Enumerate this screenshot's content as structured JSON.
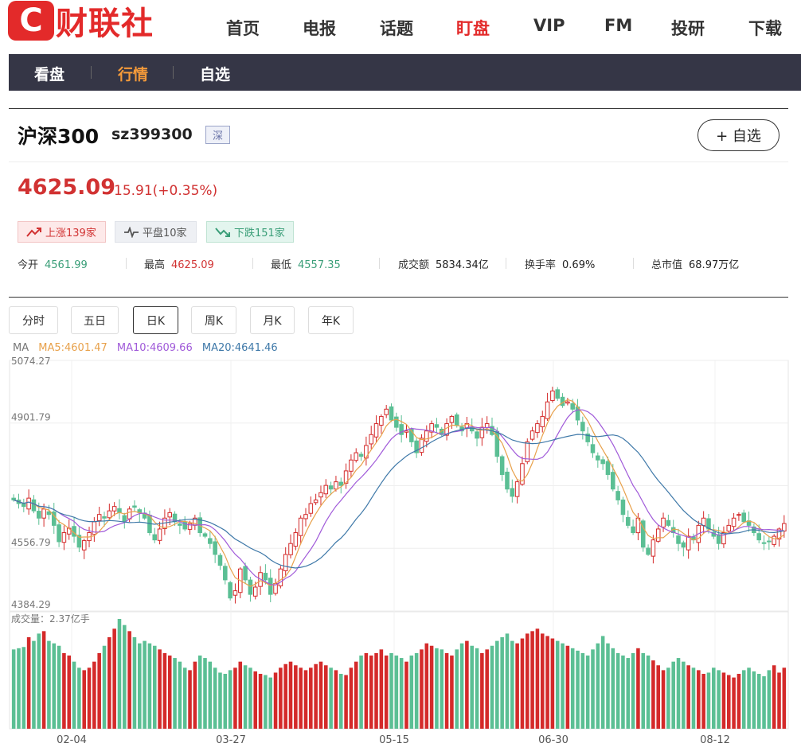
{
  "logo": {
    "letter": "C",
    "name": "财联社"
  },
  "nav": [
    "首页",
    "电报",
    "话题",
    "盯盘",
    "VIP",
    "FM",
    "投研",
    "下载"
  ],
  "nav_active": "盯盘",
  "subnav": [
    "看盘",
    "行情",
    "自选"
  ],
  "subnav_active": "行情",
  "stock": {
    "name": "沪深300",
    "code": "sz399300",
    "tag": "深",
    "add_label": "+ 自选",
    "price": "4625.09",
    "change": "15.91(+0.35%)"
  },
  "badges": {
    "up": "上涨139家",
    "flat": "平盘10家",
    "down": "下跌151家"
  },
  "stats": [
    {
      "label": "今开",
      "value": "4561.99",
      "color": "g"
    },
    {
      "label": "最高",
      "value": "4625.09",
      "color": "r"
    },
    {
      "label": "最低",
      "value": "4557.35",
      "color": "g"
    },
    {
      "label": "成交额",
      "value": "5834.34亿",
      "color": "k"
    },
    {
      "label": "换手率",
      "value": "0.69%",
      "color": "k"
    },
    {
      "label": "总市值",
      "value": "68.97万亿",
      "color": "k"
    }
  ],
  "tabs": [
    "分时",
    "五日",
    "日K",
    "周K",
    "月K",
    "年K"
  ],
  "tab_active": "日K",
  "ma": {
    "label": "MA",
    "ma5": "MA5:4601.47",
    "ma10": "MA10:4609.66",
    "ma20": "MA20:4641.46"
  },
  "colors": {
    "up": "#d42a2a",
    "down": "#5bbf94",
    "ma5": "#e8a14b",
    "ma10": "#a05ad9",
    "ma20": "#3e78a8",
    "accent": "#e32a2a"
  },
  "chart_data": {
    "type": "candlestick",
    "y_ticks": [
      "5074.27",
      "4901.79",
      "4556.79",
      "4384.29"
    ],
    "ylim": [
      4384.29,
      5074.27
    ],
    "x_ticks": [
      "02-04",
      "03-27",
      "05-15",
      "06-30",
      "08-12"
    ],
    "volume_label": "成交量：2.37亿手",
    "close": [
      4690,
      4680,
      4672,
      4695,
      4660,
      4640,
      4665,
      4650,
      4620,
      4575,
      4600,
      4612,
      4590,
      4560,
      4578,
      4600,
      4630,
      4650,
      4640,
      4660,
      4672,
      4655,
      4630,
      4665,
      4670,
      4655,
      4640,
      4600,
      4580,
      4610,
      4640,
      4655,
      4630,
      4620,
      4610,
      4625,
      4640,
      4600,
      4590,
      4570,
      4540,
      4510,
      4470,
      4420,
      4440,
      4500,
      4470,
      4430,
      4450,
      4490,
      4470,
      4430,
      4460,
      4500,
      4540,
      4570,
      4600,
      4640,
      4650,
      4680,
      4690,
      4710,
      4730,
      4720,
      4740,
      4730,
      4770,
      4800,
      4820,
      4810,
      4840,
      4870,
      4900,
      4920,
      4940,
      4910,
      4890,
      4870,
      4880,
      4850,
      4820,
      4860,
      4880,
      4900,
      4890,
      4870,
      4900,
      4920,
      4895,
      4880,
      4900,
      4880,
      4860,
      4890,
      4900,
      4870,
      4810,
      4760,
      4720,
      4700,
      4740,
      4790,
      4850,
      4880,
      4900,
      4920,
      4960,
      4990,
      4970,
      4950,
      4960,
      4940,
      4910,
      4880,
      4850,
      4820,
      4800,
      4790,
      4760,
      4720,
      4690,
      4650,
      4620,
      4600,
      4640,
      4560,
      4540,
      4580,
      4610,
      4640,
      4620,
      4600,
      4570,
      4560,
      4590,
      4580,
      4620,
      4640,
      4610,
      4590,
      4570,
      4600,
      4620,
      4640,
      4650,
      4630,
      4620,
      4600,
      4580,
      4570,
      4575,
      4590,
      4610,
      4625
    ],
    "volume": [
      0.65,
      0.66,
      0.67,
      0.75,
      0.72,
      0.78,
      0.8,
      0.72,
      0.7,
      0.68,
      0.62,
      0.6,
      0.55,
      0.5,
      0.48,
      0.5,
      0.55,
      0.62,
      0.68,
      0.75,
      0.82,
      0.9,
      0.85,
      0.8,
      0.75,
      0.7,
      0.72,
      0.7,
      0.68,
      0.65,
      0.62,
      0.6,
      0.58,
      0.55,
      0.5,
      0.48,
      0.55,
      0.6,
      0.58,
      0.55,
      0.5,
      0.46,
      0.45,
      0.48,
      0.5,
      0.55,
      0.52,
      0.5,
      0.47,
      0.45,
      0.44,
      0.42,
      0.46,
      0.5,
      0.53,
      0.55,
      0.52,
      0.5,
      0.48,
      0.5,
      0.53,
      0.55,
      0.52,
      0.5,
      0.48,
      0.45,
      0.44,
      0.5,
      0.55,
      0.6,
      0.62,
      0.6,
      0.62,
      0.65,
      0.6,
      0.62,
      0.6,
      0.58,
      0.55,
      0.6,
      0.62,
      0.65,
      0.7,
      0.68,
      0.66,
      0.65,
      0.62,
      0.6,
      0.65,
      0.7,
      0.72,
      0.68,
      0.66,
      0.62,
      0.65,
      0.68,
      0.72,
      0.75,
      0.78,
      0.72,
      0.7,
      0.74,
      0.78,
      0.8,
      0.82,
      0.78,
      0.76,
      0.74,
      0.72,
      0.7,
      0.68,
      0.66,
      0.64,
      0.62,
      0.6,
      0.65,
      0.7,
      0.76,
      0.7,
      0.66,
      0.62,
      0.6,
      0.58,
      0.62,
      0.66,
      0.62,
      0.6,
      0.56,
      0.52,
      0.48,
      0.5,
      0.55,
      0.58,
      0.55,
      0.52,
      0.5,
      0.48,
      0.45,
      0.46,
      0.5,
      0.48,
      0.46,
      0.44,
      0.42,
      0.45,
      0.48,
      0.5,
      0.47,
      0.45,
      0.43,
      0.48,
      0.52,
      0.46,
      0.5
    ]
  }
}
